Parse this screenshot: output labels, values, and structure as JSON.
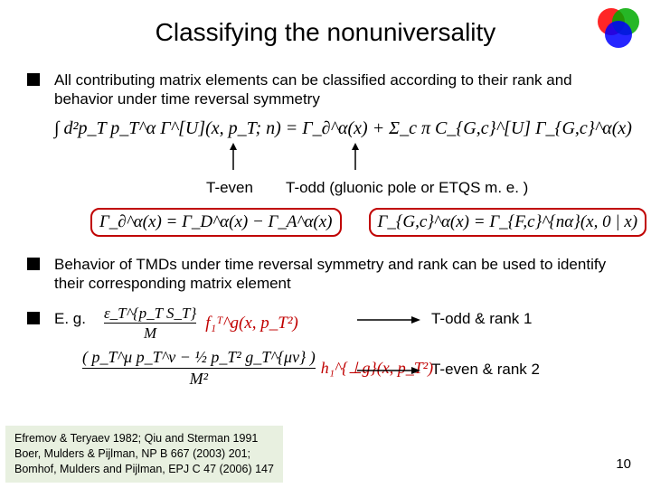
{
  "title": "Classifying the nonuniversality",
  "bullets": {
    "b1": "All contributing matrix elements can be classified according to their rank and behavior under time reversal symmetry",
    "b2": "Behavior of TMDs under time reversal symmetry and rank can be used to identify their corresponding matrix element",
    "b3": "E. g."
  },
  "formulas": {
    "main": "∫ d²p_T  p_T^α Γ^[U](x, p_T; n)  =  Γ_∂^α(x) + Σ_c π C_{G,c}^[U] Γ_{G,c}^α(x)",
    "def1": "Γ_∂^α(x) = Γ_D^α(x) − Γ_A^α(x)",
    "def2": "Γ_{G,c}^α(x) = Γ_{F,c}^{nα}(x, 0 | x)",
    "eg1_lhs_num": "ε_T^{p_T S_T}",
    "eg1_lhs_den": "M",
    "eg1_rhs": "f₁ᵀ^g(x, p_T²)",
    "eg2_lhs_num": "( p_T^μ p_T^ν − ½ p_T² g_T^{μν} )",
    "eg2_lhs_den": "M²",
    "eg2_rhs": "h₁^{⊥g}(x, p_T²)"
  },
  "labels": {
    "teven": "T-even",
    "todd": "T-odd (gluonic pole or ETQS m. e. )",
    "todd_rank1": "T-odd   & rank 1",
    "teven_rank2": "T-even & rank 2"
  },
  "refs": {
    "l1": "Efremov & Teryaev 1982; Qiu and Sterman 1991",
    "l2": "Boer, Mulders & Pijlman, NP B 667 (2003) 201;",
    "l3": "Bomhof, Mulders and Pijlman, EPJ C 47 (2006) 147"
  },
  "page": "10"
}
